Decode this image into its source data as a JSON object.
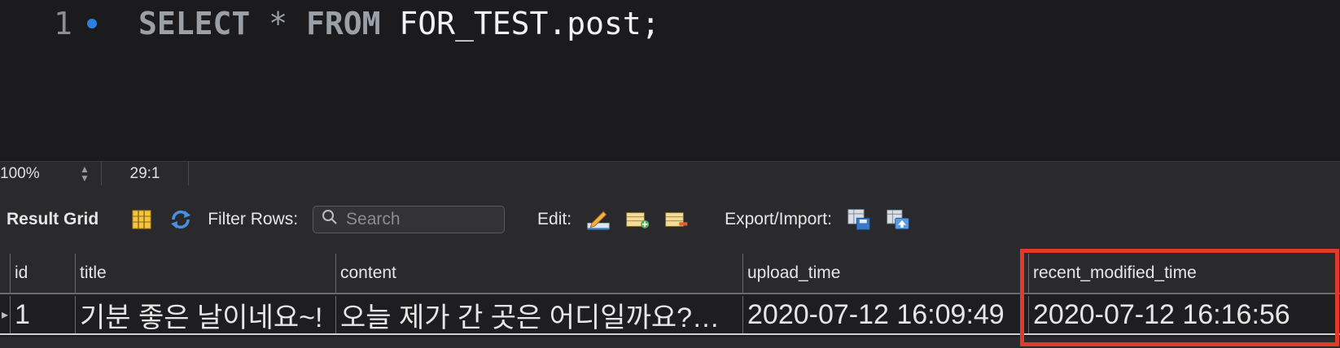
{
  "editor": {
    "line_number": "1",
    "code": {
      "kw_select": "SELECT",
      "star": "*",
      "kw_from": "FROM",
      "table": "FOR_TEST.post;"
    }
  },
  "statusbar": {
    "zoom": "100%",
    "cursor_position": "29:1"
  },
  "toolbar": {
    "result_grid_label": "Result Grid",
    "filter_rows_label": "Filter Rows:",
    "search_placeholder": "Search",
    "edit_label": "Edit:",
    "export_import_label": "Export/Import:"
  },
  "grid": {
    "columns": [
      "id",
      "title",
      "content",
      "upload_time",
      "recent_modified_time"
    ],
    "rows": [
      [
        "1",
        "기분 좋은 날이네요~!",
        "오늘 제가 간 곳은 어디일까요?…",
        "2020-07-12 16:09:49",
        "2020-07-12 16:16:56"
      ]
    ]
  },
  "colors": {
    "highlight": "#e03a2b",
    "accent_dot": "#2d7fe0"
  },
  "icons": [
    "grid-layout-icon",
    "refresh-icon",
    "search-icon",
    "edit-pencil-icon",
    "add-row-icon",
    "delete-row-icon",
    "export-icon",
    "import-icon",
    "stepper-icon"
  ]
}
